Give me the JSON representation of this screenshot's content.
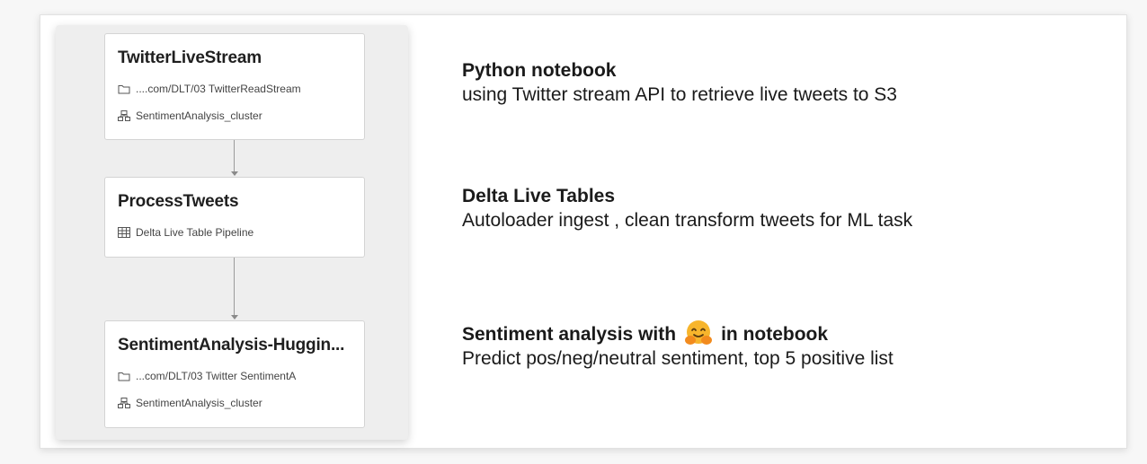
{
  "pipeline": {
    "tasks": [
      {
        "title": "TwitterLiveStream",
        "path": "....com/DLT/03 TwitterReadStream",
        "cluster": "SentimentAnalysis_cluster"
      },
      {
        "title": "ProcessTweets",
        "pipeline": "Delta Live Table Pipeline"
      },
      {
        "title": "SentimentAnalysis-Huggin...",
        "path": "...com/DLT/03 Twitter SentimentA",
        "cluster": "SentimentAnalysis_cluster"
      }
    ]
  },
  "descriptions": [
    {
      "title": "Python notebook",
      "text": "using Twitter stream API to retrieve live tweets to S3"
    },
    {
      "title": "Delta Live Tables",
      "text": "Autoloader ingest , clean transform tweets for ML task"
    },
    {
      "title_before": "Sentiment analysis with",
      "title_after": "in notebook",
      "emoji": "hugging-face-emoji",
      "text": "Predict pos/neg/neutral sentiment, top 5 positive list"
    }
  ],
  "icons": {
    "folder": "folder-icon",
    "cluster": "cluster-icon",
    "table": "table-icon"
  },
  "colors": {
    "emoji_face": "#f7b52c",
    "emoji_hands": "#f28b1e"
  }
}
